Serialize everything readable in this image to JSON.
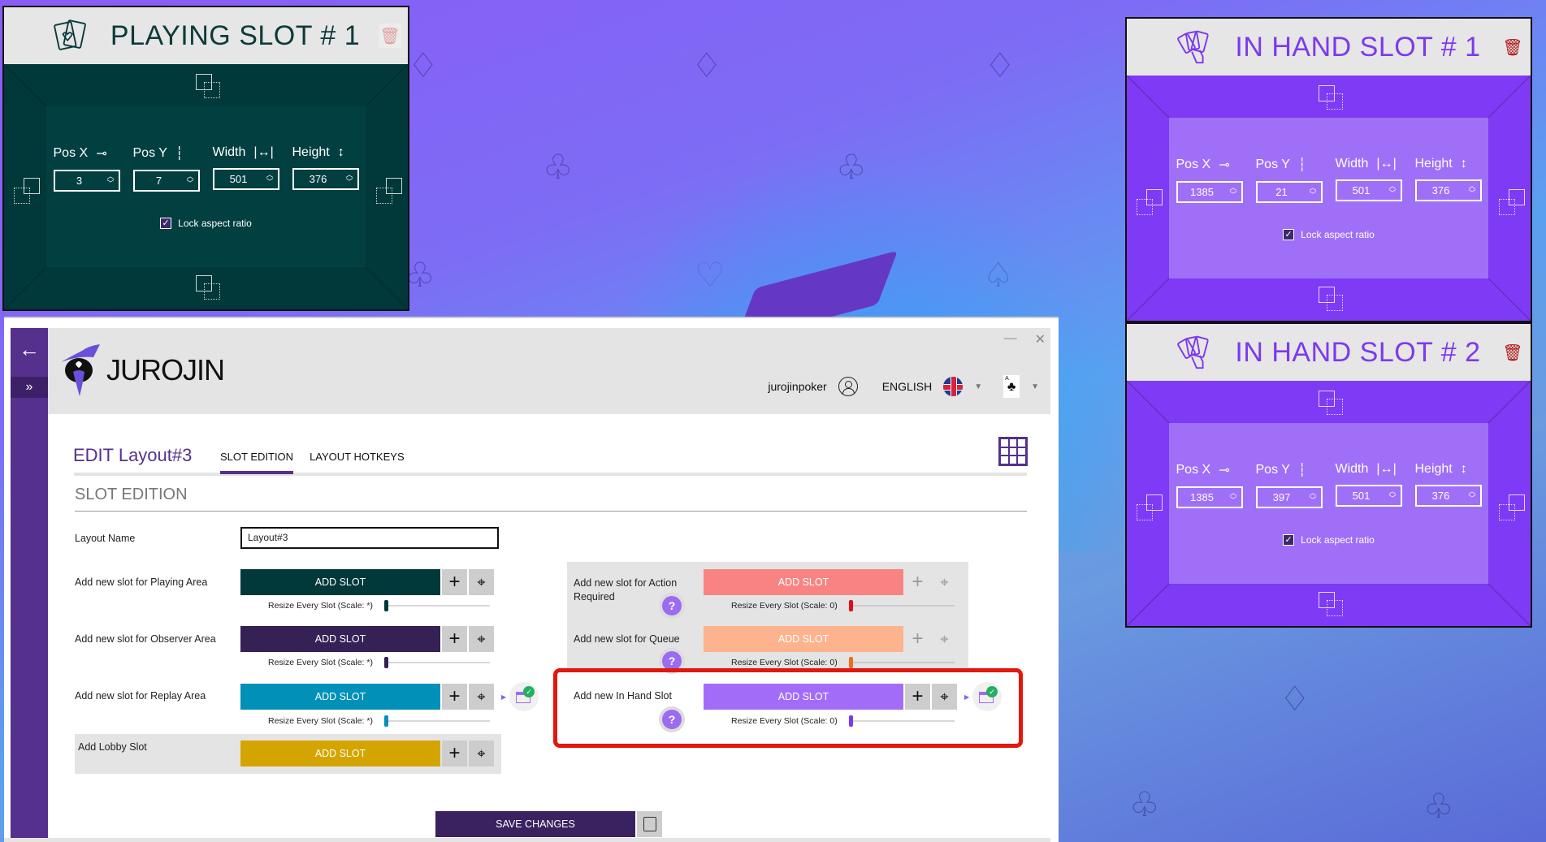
{
  "background": {
    "suits": [
      "diamond",
      "diamond",
      "diamond",
      "diamond",
      "club",
      "club",
      "club",
      "club",
      "heart",
      "spade",
      "diamond",
      "club",
      "club"
    ]
  },
  "playing_slot": {
    "title": "PLAYING SLOT # 1",
    "icon": "cards-heart-icon",
    "color_outer": "#01383a",
    "color_inner": "#023f41",
    "title_color": "#0d3a3a",
    "fields": [
      {
        "label": "Pos X",
        "glyph": "⊸",
        "value": "3"
      },
      {
        "label": "Pos Y",
        "glyph": "┆",
        "value": "7"
      },
      {
        "label": "Width",
        "glyph": "|↔|",
        "value": "501"
      },
      {
        "label": "Height",
        "glyph": "↕",
        "value": "376"
      }
    ],
    "lock_label": "Lock aspect ratio",
    "lock_checked": true
  },
  "in_hand_slots": [
    {
      "title": "IN HAND SLOT # 1",
      "icon": "hand-cards-icon",
      "fields": [
        {
          "label": "Pos X",
          "glyph": "⊸",
          "value": "1385"
        },
        {
          "label": "Pos Y",
          "glyph": "┆",
          "value": "21"
        },
        {
          "label": "Width",
          "glyph": "|↔|",
          "value": "501"
        },
        {
          "label": "Height",
          "glyph": "↕",
          "value": "376"
        }
      ],
      "lock_label": "Lock aspect ratio",
      "lock_checked": true
    },
    {
      "title": "IN HAND SLOT # 2",
      "icon": "hand-cards-icon",
      "fields": [
        {
          "label": "Pos X",
          "glyph": "⊸",
          "value": "1385"
        },
        {
          "label": "Pos Y",
          "glyph": "┆",
          "value": "397"
        },
        {
          "label": "Width",
          "glyph": "|↔|",
          "value": "501"
        },
        {
          "label": "Height",
          "glyph": "↕",
          "value": "376"
        }
      ],
      "lock_label": "Lock aspect ratio",
      "lock_checked": true
    }
  ],
  "app": {
    "brand": "JUROJIN",
    "window_controls": {
      "minimize": "—",
      "close": "✕"
    },
    "username": "jurojinpoker",
    "language": "ENGLISH",
    "deck_card": "A",
    "edit_title": "EDIT Layout#3",
    "tabs": [
      {
        "label": "SLOT EDITION",
        "active": true
      },
      {
        "label": "LAYOUT HOTKEYS",
        "active": false
      }
    ],
    "section_title": "SLOT EDITION",
    "layout_name_label": "Layout Name",
    "layout_name_value": "Layout#3",
    "left_rows": [
      {
        "label": "Add new slot for Playing Area",
        "button": "ADD SLOT",
        "color": "#01383a",
        "resize_label": "Resize Every Slot (Scale: *)",
        "slider_value": 0
      },
      {
        "label": "Add new slot for Observer Area",
        "button": "ADD SLOT",
        "color": "#352156",
        "resize_label": "Resize Every Slot (Scale: *)",
        "slider_value": 0
      },
      {
        "label": "Add new slot for Replay Area",
        "button": "ADD SLOT",
        "color": "#0090b8",
        "resize_label": "Resize Every Slot (Scale: *)",
        "slider_value": 0
      },
      {
        "label": "Add Lobby Slot",
        "button": "ADD SLOT",
        "color": "#d4a500"
      }
    ],
    "right_rows": [
      {
        "label": "Add new slot for Action Required",
        "button": "ADD SLOT",
        "color": "#f88383",
        "thumb_color": "#e50f0f",
        "resize_label": "Resize Every Slot (Scale: 0)",
        "slider_value": 0
      },
      {
        "label": "Add new slot for Queue",
        "button": "ADD SLOT",
        "color": "#fdb38d",
        "thumb_color": "#f26a1b",
        "resize_label": "Resize Every Slot (Scale: 0)",
        "slider_value": 0
      },
      {
        "label": "Add new In Hand Slot",
        "button": "ADD SLOT",
        "color": "#a36cf8",
        "thumb_color": "#7c3aed",
        "resize_label": "Resize Every Slot (Scale: 0)",
        "slider_value": 0
      }
    ],
    "help_glyph": "?",
    "save_label": "SAVE CHANGES"
  }
}
